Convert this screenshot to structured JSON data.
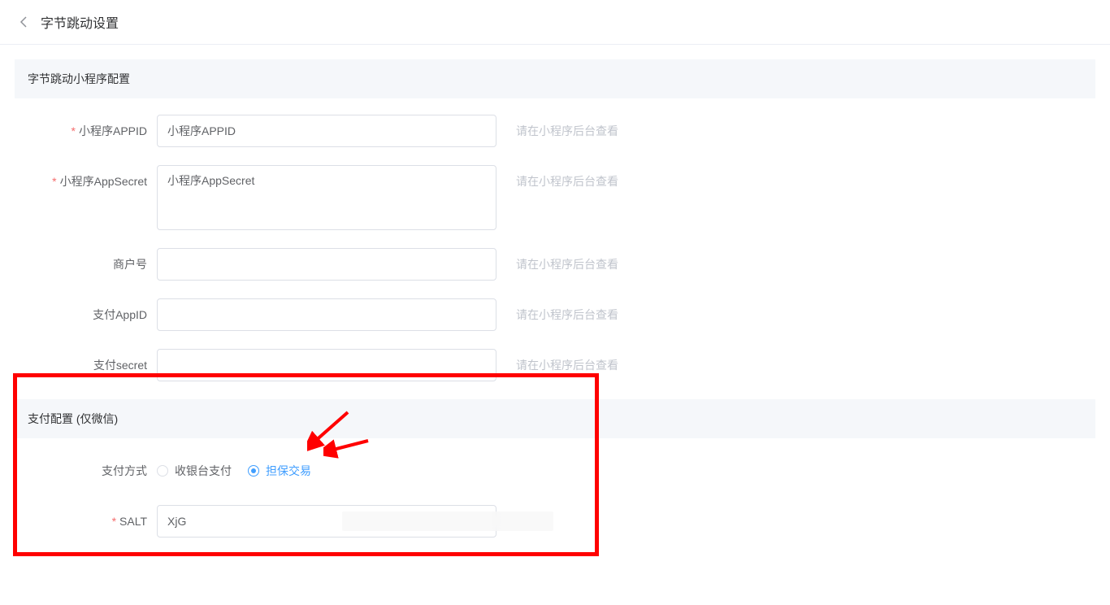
{
  "header": {
    "title": "字节跳动设置"
  },
  "section1": {
    "title": "字节跳动小程序配置",
    "fields": {
      "appid": {
        "label": "小程序APPID",
        "value": "小程序APPID",
        "required": true
      },
      "appsecret": {
        "label": "小程序AppSecret",
        "value": "小程序AppSecret",
        "required": true
      },
      "merchant": {
        "label": "商户号",
        "value": "",
        "required": false
      },
      "payAppId": {
        "label": "支付AppID",
        "value": "",
        "required": false
      },
      "paySecret": {
        "label": "支付secret",
        "value": "",
        "required": false
      }
    },
    "hint": "请在小程序后台查看"
  },
  "section2": {
    "title": "支付配置 (仅微信)",
    "payMethod": {
      "label": "支付方式",
      "options": {
        "cashier": "收银台支付",
        "secured": "担保交易"
      },
      "selected": "secured"
    },
    "salt": {
      "label": "SALT",
      "value": "XjG",
      "required": true
    }
  },
  "annotations": {
    "highlight_color": "#ff0000"
  }
}
